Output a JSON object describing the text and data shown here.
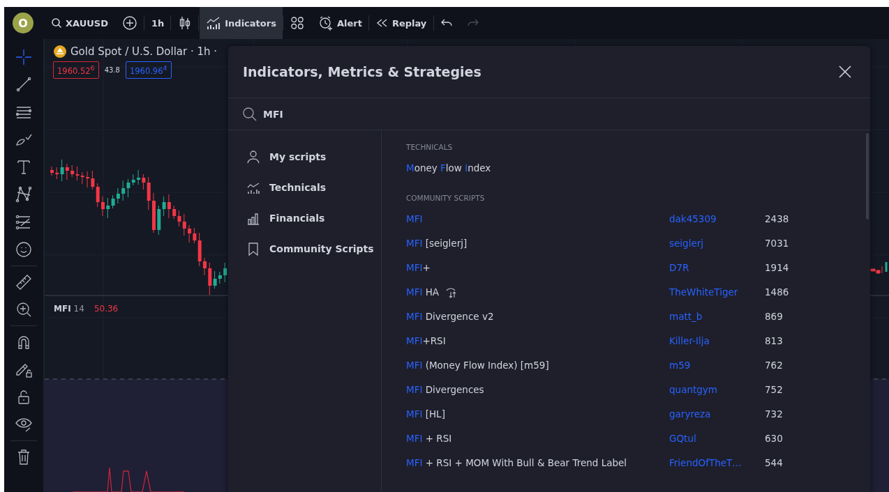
{
  "toolbar": [
    {
      "kind": "avatar",
      "label": "O"
    },
    {
      "kind": "symbol",
      "label": "XAUUSD",
      "selected": false
    },
    {
      "kind": "add",
      "selected": false
    },
    {
      "kind": "interval",
      "label": "1h",
      "selected": false
    },
    {
      "kind": "candles",
      "selected": false
    },
    {
      "kind": "indicators",
      "label": "Indicators",
      "selected": true
    },
    {
      "kind": "layouts",
      "selected": false
    },
    {
      "kind": "alert",
      "label": "Alert",
      "selected": false
    },
    {
      "kind": "replay",
      "label": "Replay",
      "selected": false
    },
    {
      "kind": "undo",
      "selected": false
    },
    {
      "kind": "redo",
      "selected": false
    }
  ],
  "tool_groups": [
    {
      "tools": [
        {
          "kind": "crosshair",
          "selected": true
        },
        {
          "kind": "line",
          "selected": false
        },
        {
          "kind": "hlines",
          "selected": false
        },
        {
          "kind": "brush",
          "selected": false
        },
        {
          "kind": "text",
          "selected": false
        },
        {
          "kind": "pattern",
          "selected": false
        },
        {
          "kind": "fib",
          "selected": false
        },
        {
          "kind": "smiley",
          "selected": false
        }
      ]
    },
    {
      "tools": [
        {
          "kind": "ruler",
          "selected": false
        },
        {
          "kind": "zoom",
          "selected": false
        }
      ]
    },
    {
      "tools": [
        {
          "kind": "magnet",
          "selected": false
        },
        {
          "kind": "pencil_lock",
          "selected": false
        },
        {
          "kind": "lock",
          "selected": false
        },
        {
          "kind": "eye",
          "selected": false
        }
      ]
    },
    {
      "tools": [
        {
          "kind": "trash",
          "selected": false
        }
      ]
    }
  ],
  "chart": {
    "title": "Gold Spot / U.S. Dollar · 1h ·",
    "bid": "1960.52$^{6}$",
    "spread": "43.8",
    "ask": "1960.96$^{4}$",
    "indicator": {
      "name": "MFI",
      "length": "14",
      "value": "50.36"
    }
  },
  "dialog": {
    "title": "Indicators, Metrics & Strategies",
    "search": {
      "value": "MFI"
    },
    "categories": [
      {
        "kind": "person",
        "label": "My scripts"
      },
      {
        "kind": "technicals",
        "label": "Technicals"
      },
      {
        "kind": "financials",
        "label": "Financials"
      },
      {
        "kind": "bookmark",
        "label": "Community Scripts"
      }
    ],
    "technicals": {
      "heading": "TECHNICALS",
      "items": [
        {
          "name": [
            {
              "text": "M",
              "match": true
            },
            {
              "text": "oney ",
              "match": false
            },
            {
              "text": "F",
              "match": true
            },
            {
              "text": "low ",
              "match": false
            },
            {
              "text": "I",
              "match": true
            },
            {
              "text": "ndex",
              "match": false
            }
          ]
        }
      ]
    },
    "community": {
      "heading": "COMMUNITY SCRIPTS",
      "items": [
        {
          "name": [
            {
              "text": "MFI",
              "match": true
            }
          ],
          "flagged": false,
          "author": "dak45309",
          "count": "2438"
        },
        {
          "name": [
            {
              "text": "MFI",
              "match": true
            },
            {
              "text": " [seiglerj]",
              "match": false
            }
          ],
          "flagged": false,
          "author": "seiglerj",
          "count": "7031"
        },
        {
          "name": [
            {
              "text": "MFI",
              "match": true
            },
            {
              "text": "+",
              "match": false
            }
          ],
          "flagged": false,
          "author": "D7R",
          "count": "1914"
        },
        {
          "name": [
            {
              "text": "MFI",
              "match": true
            },
            {
              "text": " HA",
              "match": false
            }
          ],
          "flagged": true,
          "author": "TheWhiteTiger",
          "count": "1486"
        },
        {
          "name": [
            {
              "text": "MFI",
              "match": true
            },
            {
              "text": " Divergence v2",
              "match": false
            }
          ],
          "flagged": false,
          "author": "matt_b",
          "count": "869"
        },
        {
          "name": [
            {
              "text": "MFI",
              "match": true
            },
            {
              "text": "+RSI",
              "match": false
            }
          ],
          "flagged": false,
          "author": "Killer-Ilja",
          "count": "813"
        },
        {
          "name": [
            {
              "text": "MFI",
              "match": true
            },
            {
              "text": " (Money Flow Index) [m59]",
              "match": false
            }
          ],
          "flagged": false,
          "author": "m59",
          "count": "762"
        },
        {
          "name": [
            {
              "text": "MFI",
              "match": true
            },
            {
              "text": " Divergences",
              "match": false
            }
          ],
          "flagged": false,
          "author": "quantgym",
          "count": "752"
        },
        {
          "name": [
            {
              "text": "MFI",
              "match": true
            },
            {
              "text": " [HL]",
              "match": false
            }
          ],
          "flagged": false,
          "author": "garyreza",
          "count": "732"
        },
        {
          "name": [
            {
              "text": "MFI",
              "match": true
            },
            {
              "text": " + RSI",
              "match": false
            }
          ],
          "flagged": false,
          "author": "GQtul",
          "count": "630"
        },
        {
          "name": [
            {
              "text": "MFI",
              "match": true
            },
            {
              "text": " + RSI + MOM With Bull & Bear Trend Label",
              "match": false
            }
          ],
          "flagged": false,
          "author": "FriendOfTheT…",
          "count": "544"
        }
      ]
    }
  }
}
